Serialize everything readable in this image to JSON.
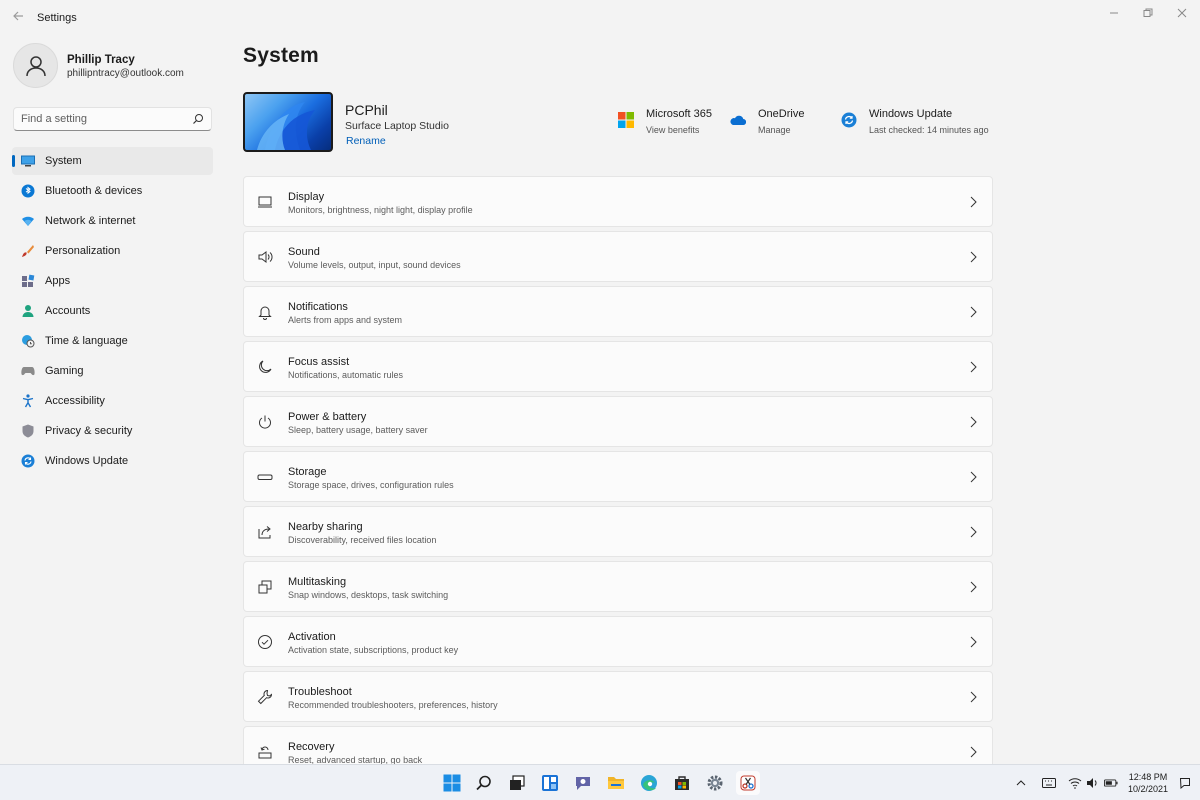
{
  "window": {
    "title": "Settings"
  },
  "profile": {
    "name": "Phillip Tracy",
    "email": "phillipntracy@outlook.com"
  },
  "search": {
    "placeholder": "Find a setting"
  },
  "sidebar": {
    "items": [
      {
        "label": "System",
        "icon": "monitor-icon",
        "active": true
      },
      {
        "label": "Bluetooth & devices",
        "icon": "bluetooth-icon"
      },
      {
        "label": "Network & internet",
        "icon": "wifi-icon"
      },
      {
        "label": "Personalization",
        "icon": "brush-icon"
      },
      {
        "label": "Apps",
        "icon": "apps-icon"
      },
      {
        "label": "Accounts",
        "icon": "person-icon"
      },
      {
        "label": "Time & language",
        "icon": "globe-clock-icon"
      },
      {
        "label": "Gaming",
        "icon": "gamepad-icon"
      },
      {
        "label": "Accessibility",
        "icon": "accessibility-icon"
      },
      {
        "label": "Privacy & security",
        "icon": "shield-icon"
      },
      {
        "label": "Windows Update",
        "icon": "update-icon"
      }
    ]
  },
  "page": {
    "title": "System"
  },
  "device": {
    "name": "PCPhil",
    "model": "Surface Laptop Studio",
    "rename_label": "Rename"
  },
  "quick_links": [
    {
      "title": "Microsoft 365",
      "subtitle": "View benefits",
      "icon": "microsoft-logo-icon"
    },
    {
      "title": "OneDrive",
      "subtitle": "Manage",
      "icon": "onedrive-cloud-icon"
    },
    {
      "title": "Windows Update",
      "subtitle": "Last checked: 14 minutes ago",
      "icon": "windows-update-icon"
    }
  ],
  "cards": [
    {
      "title": "Display",
      "subtitle": "Monitors, brightness, night light, display profile",
      "icon": "display-icon"
    },
    {
      "title": "Sound",
      "subtitle": "Volume levels, output, input, sound devices",
      "icon": "speaker-icon"
    },
    {
      "title": "Notifications",
      "subtitle": "Alerts from apps and system",
      "icon": "bell-icon"
    },
    {
      "title": "Focus assist",
      "subtitle": "Notifications, automatic rules",
      "icon": "moon-icon"
    },
    {
      "title": "Power & battery",
      "subtitle": "Sleep, battery usage, battery saver",
      "icon": "power-icon"
    },
    {
      "title": "Storage",
      "subtitle": "Storage space, drives, configuration rules",
      "icon": "storage-drive-icon"
    },
    {
      "title": "Nearby sharing",
      "subtitle": "Discoverability, received files location",
      "icon": "share-icon"
    },
    {
      "title": "Multitasking",
      "subtitle": "Snap windows, desktops, task switching",
      "icon": "multitask-icon"
    },
    {
      "title": "Activation",
      "subtitle": "Activation state, subscriptions, product key",
      "icon": "check-circle-icon"
    },
    {
      "title": "Troubleshoot",
      "subtitle": "Recommended troubleshooters, preferences, history",
      "icon": "wrench-icon"
    },
    {
      "title": "Recovery",
      "subtitle": "Reset, advanced startup, go back",
      "icon": "recovery-icon"
    }
  ],
  "taskbar": {
    "apps": [
      "start-icon",
      "search-icon",
      "task-view-icon",
      "widgets-icon",
      "teams-chat-icon",
      "file-explorer-icon",
      "edge-icon",
      "store-icon",
      "settings-icon",
      "snipping-tool-icon"
    ],
    "time": "12:48 PM",
    "date": "10/2/2021"
  },
  "colors": {
    "accent": "#0067c0",
    "link": "#005fb8",
    "background": "#f3f3f3",
    "card": "#fbfbfb"
  }
}
